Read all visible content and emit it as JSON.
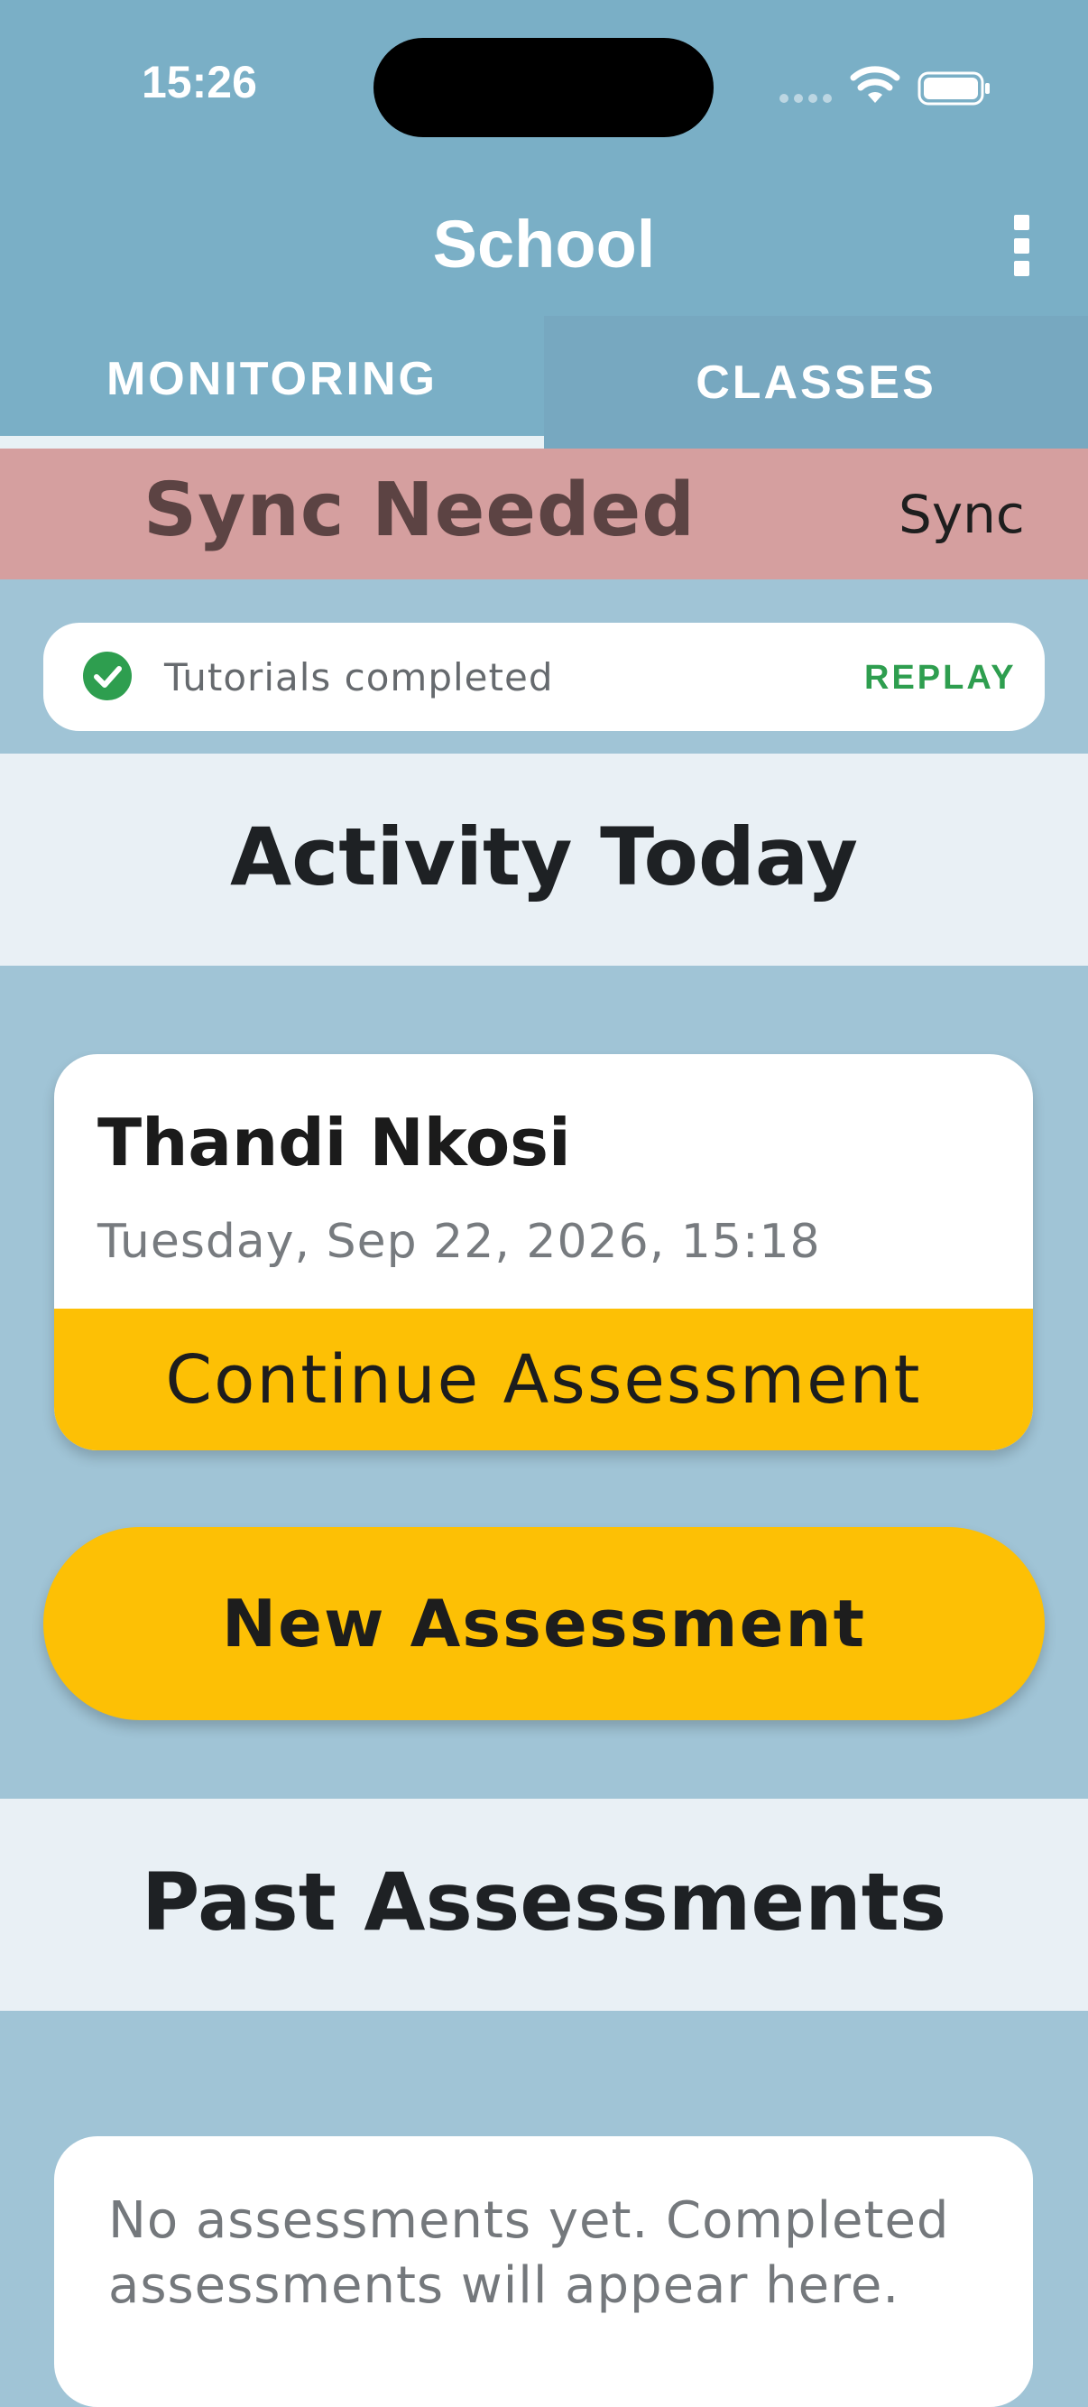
{
  "status_bar": {
    "time": "15:26"
  },
  "app_bar": {
    "title": "School"
  },
  "tabs": [
    {
      "label": "MONITORING",
      "selected": true
    },
    {
      "label": "CLASSES",
      "selected": false
    }
  ],
  "sync_banner": {
    "message": "Sync Needed",
    "action_label": "Sync"
  },
  "tutorials": {
    "label": "Tutorials completed",
    "action_label": "REPLAY"
  },
  "activity": {
    "heading": "Activity Today",
    "card": {
      "student_name": "Thandi Nkosi",
      "datetime": "Tuesday, Sep 22, 2026, 15:18",
      "cta_label": "Continue Assessment"
    },
    "new_button_label": "New Assessment"
  },
  "past": {
    "heading": "Past Assessments",
    "empty_message": "No assessments yet. Completed assessments will appear here."
  },
  "colors": {
    "app_bar": "#7aafc6",
    "background": "#a0c4d6",
    "sync_banner": "#d59f9f",
    "accent_yellow": "#fdc005",
    "success_green": "#2e9e4f"
  }
}
